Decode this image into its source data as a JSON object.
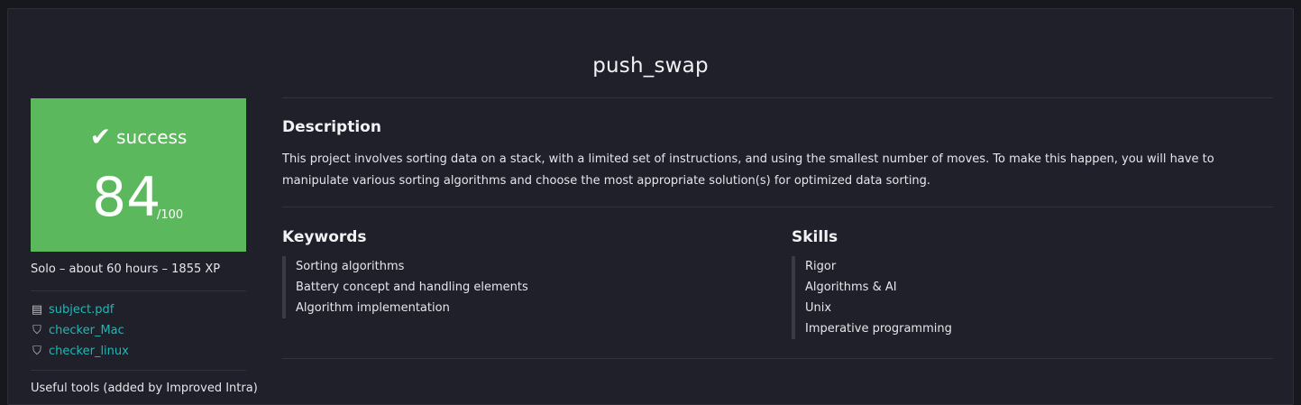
{
  "project": {
    "title": "push_swap"
  },
  "status": {
    "label": "success",
    "score": "84",
    "max": "/100",
    "icon": "check-icon",
    "color": "#5cb85c"
  },
  "meta": "Solo – about 60 hours – 1855 XP",
  "files": [
    {
      "label": "subject.pdf",
      "icon": "document-icon"
    },
    {
      "label": "checker_Mac",
      "icon": "shield-icon"
    },
    {
      "label": "checker_linux",
      "icon": "shield-icon"
    }
  ],
  "tools_label": "Useful tools (added by Improved Intra)",
  "description": {
    "heading": "Description",
    "text": "This project involves sorting data on a stack, with a limited set of instructions, and using the smallest number of moves. To make this happen, you will have to manipulate various sorting algorithms and choose the most appropriate solution(s) for optimized data sorting."
  },
  "keywords": {
    "heading": "Keywords",
    "items": [
      "Sorting algorithms",
      "Battery concept and handling elements",
      "Algorithm implementation"
    ]
  },
  "skills": {
    "heading": "Skills",
    "items": [
      "Rigor",
      "Algorithms & AI",
      "Unix",
      "Imperative programming"
    ]
  },
  "colors": {
    "background": "#1f2029",
    "link": "#1fb8b8"
  }
}
